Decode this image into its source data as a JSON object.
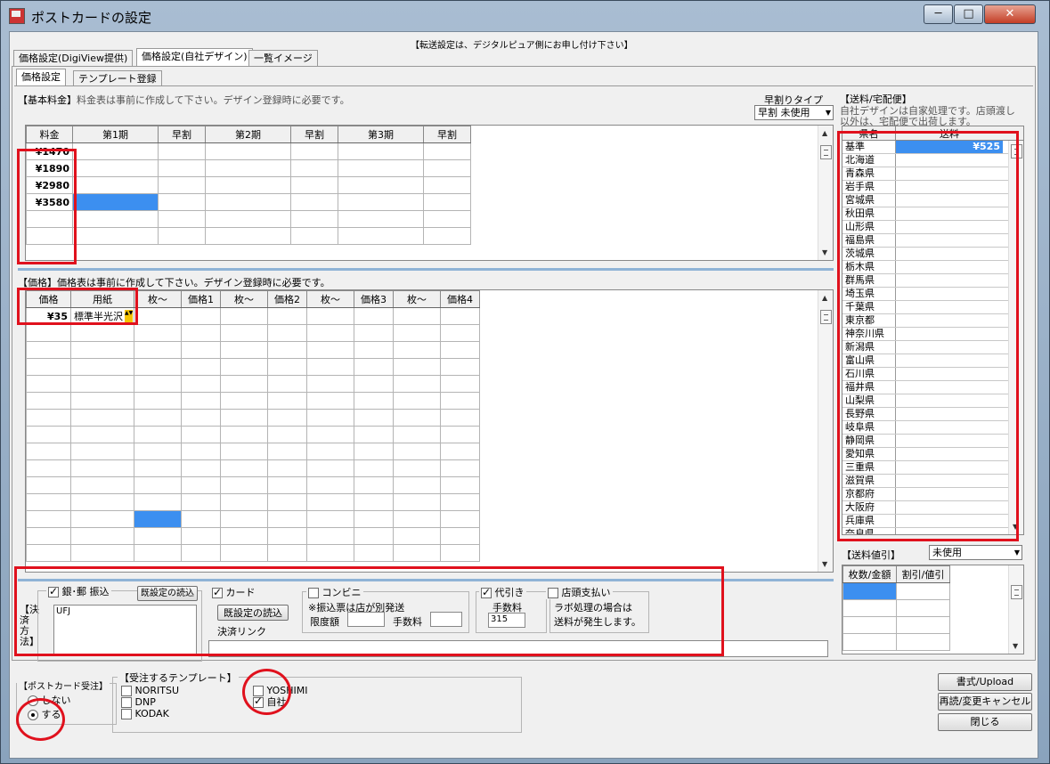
{
  "window": {
    "title": "ポストカードの設定",
    "min_label": "─",
    "max_label": "□",
    "close_label": "✕"
  },
  "notice": "【転送設定は、デジタルピュア側にお申し付け下さい】",
  "main_tabs": [
    "価格設定(DigiView提供)",
    "価格設定(自社デザイン)",
    "一覧イメージ"
  ],
  "sub_tabs": [
    "価格設定",
    "テンプレート登録"
  ],
  "basic": {
    "label": "【基本料金】",
    "desc": "料金表は事前に作成して下さい。デザイン登録時に必要です。",
    "early_type_label": "早割りタイプ",
    "early_type_value": "早割 未使用",
    "headers": [
      "料金",
      "第1期",
      "早割",
      "第2期",
      "早割",
      "第3期",
      "早割"
    ],
    "fees": [
      "¥1470",
      "¥1890",
      "¥2980",
      "¥3580"
    ]
  },
  "price": {
    "label": "【価格】",
    "desc": "価格表は事前に作成して下さい。デザイン登録時に必要です。",
    "headers": [
      "価格",
      "用紙",
      "枚～",
      "価格1",
      "枚～",
      "価格2",
      "枚～",
      "価格3",
      "枚～",
      "価格4"
    ],
    "row1_price": "¥35",
    "row1_paper": "標準半光沢"
  },
  "payment": {
    "bank_label": "銀･郵 振込",
    "bank_value": "UFJ",
    "load_label": "既設定の読込",
    "side_label": "【決済方法】",
    "card_label": "カード",
    "card_load_label": "既設定の読込",
    "card_link_label": "決済リンク",
    "conv_label": "コンビニ",
    "conv_note": "※振込票は店が別発送",
    "limit_label": "限度額",
    "fee_label": "手数料",
    "cod_label": "代引き",
    "cod_fee_label": "手数料",
    "cod_fee_value": "315",
    "store_label": "店頭支払い",
    "store_note1": "ラボ処理の場合は",
    "store_note2": "送料が発生します。"
  },
  "shipping": {
    "label": "【送料/宅配便】",
    "desc1": "自社デザインは自家処理です。店頭渡し",
    "desc2": "以外は、宅配便で出荷します。",
    "col1": "県名",
    "col2": "送料",
    "base_label": "基準",
    "base_value": "¥525",
    "prefectures": [
      "北海道",
      "青森県",
      "岩手県",
      "宮城県",
      "秋田県",
      "山形県",
      "福島県",
      "茨城県",
      "栃木県",
      "群馬県",
      "埼玉県",
      "千葉県",
      "東京都",
      "神奈川県",
      "新潟県",
      "富山県",
      "石川県",
      "福井県",
      "山梨県",
      "長野県",
      "岐阜県",
      "静岡県",
      "愛知県",
      "三重県",
      "滋賀県",
      "京都府",
      "大阪府",
      "兵庫県",
      "奈良県"
    ]
  },
  "discount": {
    "label": "【送料値引】",
    "select_value": "未使用",
    "col1": "枚数/金額",
    "col2": "割引/値引"
  },
  "order": {
    "label": "【ポストカード受注】",
    "no_label": "しない",
    "yes_label": "する"
  },
  "templates": {
    "label": "【受注するテンプレート】",
    "items": [
      "NORITSU",
      "DNP",
      "KODAK"
    ],
    "items2": [
      "YOSHIMI",
      "自社"
    ]
  },
  "buttons": {
    "upload": "書式/Upload",
    "reload": "再読/変更キャンセル",
    "close": "閉じる"
  }
}
